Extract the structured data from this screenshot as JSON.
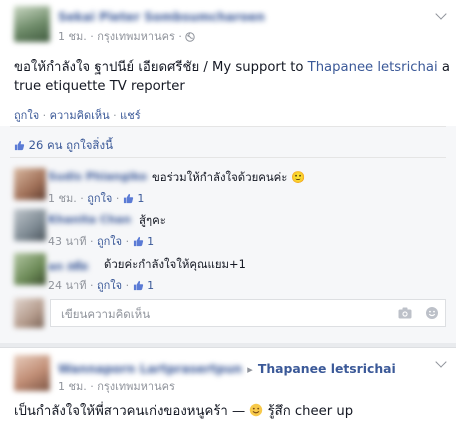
{
  "post1": {
    "author": "Sekai Pieter Sombsumcharoen",
    "time": "1 ชม.",
    "location": "กรุงเทพมหานคร",
    "text_prefix": "ขอให้กำลังใจ ฐาปนีย์ เอียดศรีชัย / My support to ",
    "text_link": "Thapanee letsrichai",
    "text_suffix": " a true etiquette TV reporter",
    "actions": {
      "like": "ถูกใจ",
      "comment": "ความคิดเห็น",
      "share": "แชร์"
    },
    "likes_summary": "26 คน ถูกใจสิ่งนี้",
    "comments": [
      {
        "name": "Sudis Phiangiko",
        "text": "ขอร่วมให้กำลังใจด้วยคนค่ะ 🙂",
        "time": "1 ชม.",
        "like_label": "ถูกใจ",
        "likes": "1"
      },
      {
        "name": "Khanita Chan",
        "text": "สู้ๆคะ",
        "time": "43 นาที",
        "like_label": "ถูกใจ",
        "likes": "1"
      },
      {
        "name": "an สตัด",
        "text": "ด้วยค่ะกำลังใจให้คุณแยม+1",
        "time": "24 นาที",
        "like_label": "ถูกใจ",
        "likes": "1"
      }
    ],
    "comment_placeholder": "เขียนความคิดเห็น",
    "icons": [
      "globe-icon",
      "thumbs-up-icon",
      "camera-icon",
      "emoji-icon",
      "chevron-down-icon"
    ]
  },
  "post2": {
    "author": "Wannaporn Lartprasertpun",
    "arrow": "▸",
    "target": "Thapanee letsrichai",
    "time": "1 ชม.",
    "location": "กรุงเทพมหานคร",
    "text_prefix": "เป็นกำลังใจให้พี่สาวคนเก่งของหนูคร้า — ",
    "feeling": "รู้สึก cheer up"
  },
  "sep": "·",
  "colors": {
    "link": "#3b5998",
    "meta": "#90949c",
    "background": "#e9ebee",
    "likes_bar": "#f6f7f9"
  }
}
